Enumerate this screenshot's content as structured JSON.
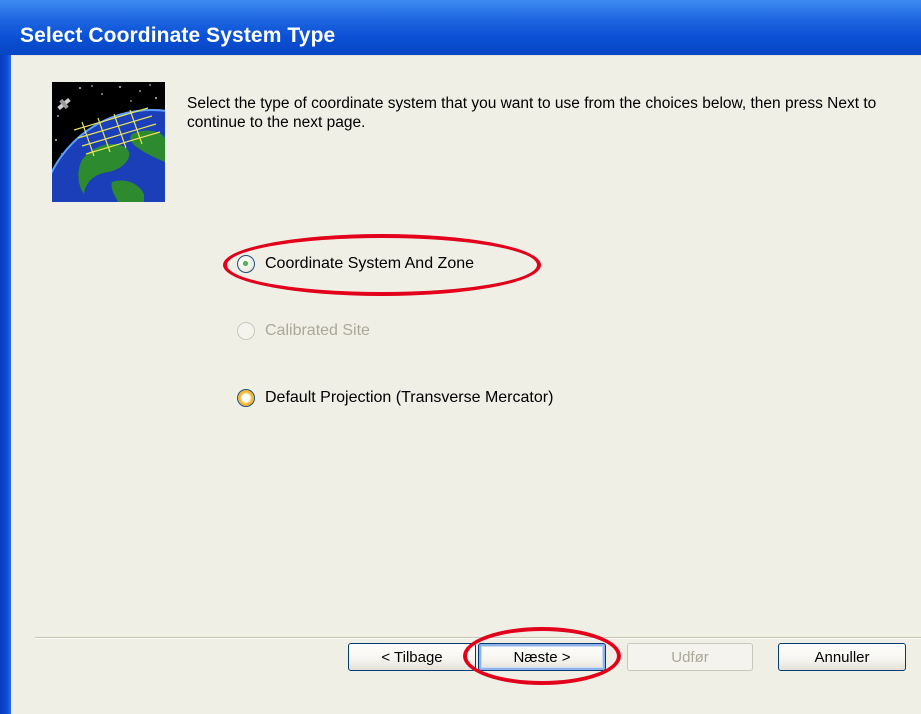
{
  "dialog": {
    "title": "Select Coordinate System Type",
    "description": "Select the type of coordinate system that you want to use from the choices below, then press Next to continue to the next page.",
    "illustration_icon": "globe-satellite-icon"
  },
  "options": [
    {
      "label": "Coordinate System And Zone",
      "selected": true,
      "enabled": true,
      "highlighted": true
    },
    {
      "label": "Calibrated Site",
      "selected": false,
      "enabled": false
    },
    {
      "label": "Default  Projection (Transverse Mercator)",
      "selected": false,
      "enabled": true
    }
  ],
  "buttons": {
    "back": "< Tilbage",
    "next": "Næste >",
    "finish": "Udfør",
    "cancel": "Annuller"
  },
  "colors": {
    "title_bar": "#0a4fd4",
    "dialog_background": "#f0efe5",
    "annotation": "#e2001a",
    "radio_dot": "#2f9a33"
  }
}
